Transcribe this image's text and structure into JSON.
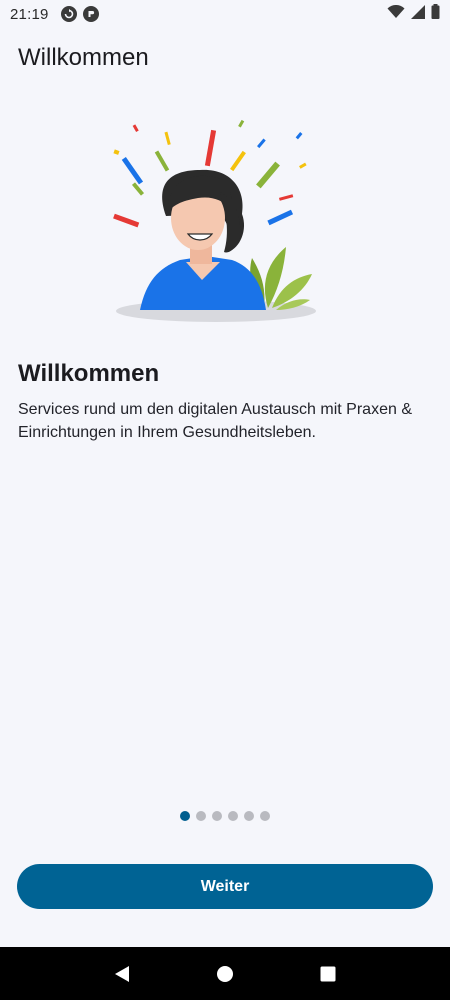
{
  "status_bar": {
    "time": "21:19",
    "left_icons": [
      "sync-icon",
      "app-notification-icon"
    ],
    "right_icons": [
      "wifi-icon",
      "signal-icon",
      "battery-icon"
    ]
  },
  "app_bar": {
    "title": "Willkommen"
  },
  "illustration": {
    "name": "welcome-illustration",
    "colors": {
      "blue": "#1a73e8",
      "red": "#e53935",
      "yellow": "#f4c20d",
      "green": "#8ab33a",
      "hair": "#2b2b2b",
      "skin": "#f5c8b0"
    }
  },
  "onboarding": {
    "heading": "Willkommen",
    "body": "Services rund um den digitalen Austausch mit Praxen & Einrichtungen in Ihrem Gesundheitsleben.",
    "page_count": 6,
    "active_page": 0
  },
  "actions": {
    "next_label": "Weiter"
  },
  "colors": {
    "background": "#f5f6fb",
    "primary": "#006394",
    "dot_active": "#005e8f",
    "dot_inactive": "#b9bac0"
  },
  "nav_bar": {
    "buttons": [
      "back-icon",
      "home-icon",
      "recents-icon"
    ]
  }
}
